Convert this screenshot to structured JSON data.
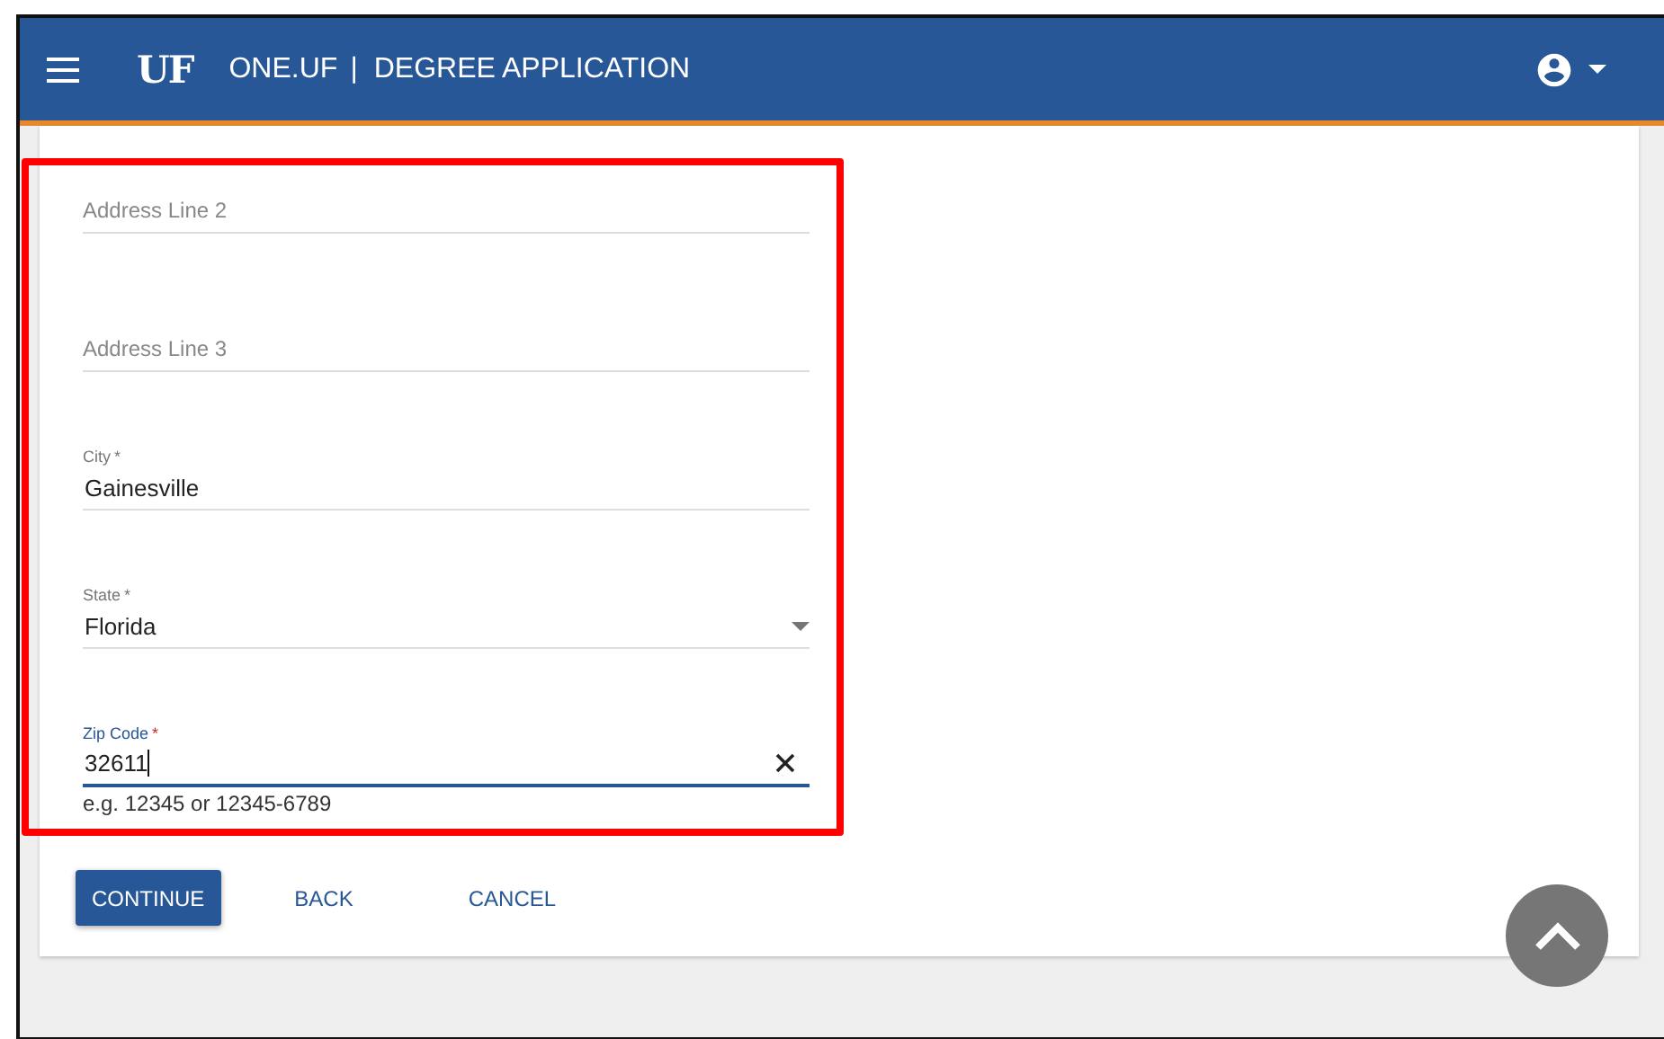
{
  "header": {
    "logo": "UF",
    "brand": "ONE.UF",
    "separator": "|",
    "title": "DEGREE APPLICATION"
  },
  "fields": [
    {
      "kind": "text",
      "placeholder": "Address Line 2",
      "focused": false
    },
    {
      "kind": "text",
      "placeholder": "Address Line 3",
      "focused": false
    },
    {
      "kind": "text",
      "label": "City",
      "mark": "*",
      "value": "Gainesville",
      "focused": false
    },
    {
      "kind": "select",
      "label": "State",
      "mark": "*",
      "value": "Florida",
      "focused": false
    },
    {
      "kind": "clearable",
      "label": "Zip Code",
      "mark": "*",
      "value": "32611",
      "focused": true,
      "hint": "e.g. 12345 or 12345-6789"
    }
  ],
  "buttons": [
    {
      "label": "CONTINUE",
      "kind": "primary"
    },
    {
      "label": "BACK",
      "kind": "flat"
    },
    {
      "label": "CANCEL",
      "kind": "flat"
    }
  ]
}
